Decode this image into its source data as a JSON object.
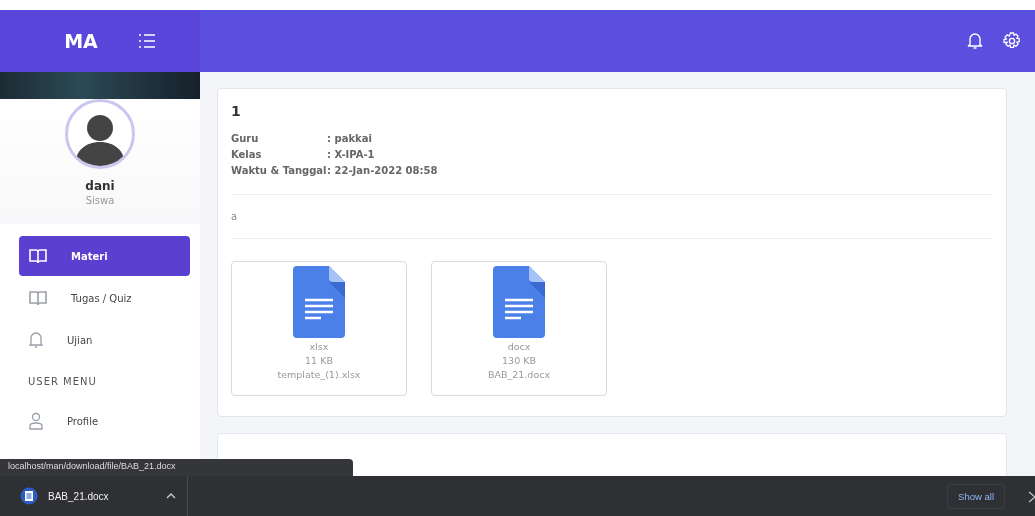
{
  "header": {
    "brand": "MA"
  },
  "profile": {
    "name": "dani",
    "role": "Siswa"
  },
  "nav": [
    {
      "label": "Materi",
      "kind": "book",
      "selected": true
    },
    {
      "label": "Tugas / Quiz",
      "kind": "book",
      "selected": false
    },
    {
      "label": "Ujian",
      "kind": "bell",
      "selected": false
    }
  ],
  "section_label": "USER MENU",
  "user_menu": [
    {
      "label": "Profile",
      "kind": "user",
      "selected": false
    }
  ],
  "material": {
    "title": "1",
    "details": [
      {
        "label": "Guru",
        "value": ": pakkai"
      },
      {
        "label": "Kelas",
        "value": ": X-IPA-1"
      },
      {
        "label": "Waktu & Tanggal",
        "value": ": 22-Jan-2022 08:58"
      }
    ],
    "description": "a",
    "files": [
      {
        "type": "xlsx",
        "size": "11 KB",
        "name": "template_(1).xlsx"
      },
      {
        "type": "docx",
        "size": "130 KB",
        "name": "BAB_21.docx"
      }
    ]
  },
  "status_url": "localhost/man/download/file/BAB_21.docx",
  "download_bar": {
    "file": "BAB_21.docx",
    "button": "Show all"
  }
}
